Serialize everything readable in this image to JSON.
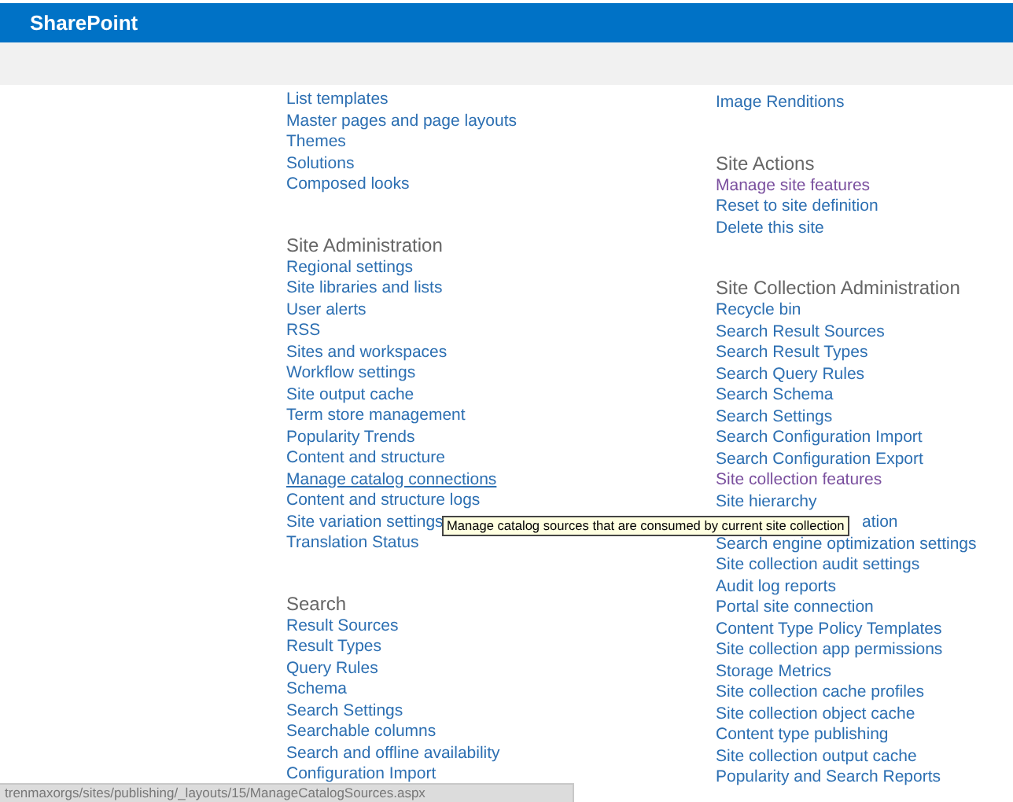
{
  "app_title": "SharePoint",
  "columns": [
    {
      "groups": [
        {
          "items": [
            {
              "label": "List templates",
              "visited": false,
              "hovered": false
            },
            {
              "label": "Master pages and page layouts",
              "visited": false,
              "hovered": false
            },
            {
              "label": "Themes",
              "visited": false,
              "hovered": false
            },
            {
              "label": "Solutions",
              "visited": false,
              "hovered": false
            },
            {
              "label": "Composed looks",
              "visited": false,
              "hovered": false
            }
          ]
        },
        {
          "heading": "Site Administration",
          "items": [
            {
              "label": "Regional settings",
              "visited": false,
              "hovered": false
            },
            {
              "label": "Site libraries and lists",
              "visited": false,
              "hovered": false
            },
            {
              "label": "User alerts",
              "visited": false,
              "hovered": false
            },
            {
              "label": "RSS",
              "visited": false,
              "hovered": false
            },
            {
              "label": "Sites and workspaces",
              "visited": false,
              "hovered": false
            },
            {
              "label": "Workflow settings",
              "visited": false,
              "hovered": false
            },
            {
              "label": "Site output cache",
              "visited": false,
              "hovered": false
            },
            {
              "label": "Term store management",
              "visited": false,
              "hovered": false
            },
            {
              "label": "Popularity Trends",
              "visited": false,
              "hovered": false
            },
            {
              "label": "Content and structure",
              "visited": false,
              "hovered": false
            },
            {
              "label": "Manage catalog connections",
              "visited": false,
              "hovered": true
            },
            {
              "label": "Content and structure logs",
              "visited": false,
              "hovered": false
            },
            {
              "label": "Site variation settings",
              "visited": false,
              "hovered": false
            },
            {
              "label": "Translation Status",
              "visited": false,
              "hovered": false
            }
          ]
        },
        {
          "heading": "Search",
          "items": [
            {
              "label": "Result Sources",
              "visited": false,
              "hovered": false
            },
            {
              "label": "Result Types",
              "visited": false,
              "hovered": false
            },
            {
              "label": "Query Rules",
              "visited": false,
              "hovered": false
            },
            {
              "label": "Schema",
              "visited": false,
              "hovered": false
            },
            {
              "label": "Search Settings",
              "visited": false,
              "hovered": false
            },
            {
              "label": "Searchable columns",
              "visited": false,
              "hovered": false
            },
            {
              "label": "Search and offline availability",
              "visited": false,
              "hovered": false
            },
            {
              "label": "Configuration Import",
              "visited": false,
              "hovered": false
            }
          ]
        }
      ]
    },
    {
      "groups": [
        {
          "items": [
            {
              "label": "Image Renditions",
              "visited": false,
              "hovered": false
            }
          ]
        },
        {
          "heading": "Site Actions",
          "items": [
            {
              "label": "Manage site features",
              "visited": true,
              "hovered": false
            },
            {
              "label": "Reset to site definition",
              "visited": false,
              "hovered": false
            },
            {
              "label": "Delete this site",
              "visited": false,
              "hovered": false
            }
          ]
        },
        {
          "heading": "Site Collection Administration",
          "items": [
            {
              "label": "Recycle bin",
              "visited": false,
              "hovered": false
            },
            {
              "label": "Search Result Sources",
              "visited": false,
              "hovered": false
            },
            {
              "label": "Search Result Types",
              "visited": false,
              "hovered": false
            },
            {
              "label": "Search Query Rules",
              "visited": false,
              "hovered": false
            },
            {
              "label": "Search Schema",
              "visited": false,
              "hovered": false
            },
            {
              "label": "Search Settings",
              "visited": false,
              "hovered": false
            },
            {
              "label": "Search Configuration Import",
              "visited": false,
              "hovered": false
            },
            {
              "label": "Search Configuration Export",
              "visited": false,
              "hovered": false
            },
            {
              "label": "Site collection features",
              "visited": true,
              "hovered": false
            },
            {
              "label": "Site hierarchy",
              "visited": false,
              "hovered": false
            },
            {
              "label": "ation",
              "visited": false,
              "hovered": false,
              "covered": true
            },
            {
              "label": "Search engine optimization settings",
              "visited": false,
              "hovered": false
            },
            {
              "label": "Site collection audit settings",
              "visited": false,
              "hovered": false
            },
            {
              "label": "Audit log reports",
              "visited": false,
              "hovered": false
            },
            {
              "label": "Portal site connection",
              "visited": false,
              "hovered": false
            },
            {
              "label": "Content Type Policy Templates",
              "visited": false,
              "hovered": false
            },
            {
              "label": "Site collection app permissions",
              "visited": false,
              "hovered": false
            },
            {
              "label": "Storage Metrics",
              "visited": false,
              "hovered": false
            },
            {
              "label": "Site collection cache profiles",
              "visited": false,
              "hovered": false
            },
            {
              "label": "Site collection object cache",
              "visited": false,
              "hovered": false
            },
            {
              "label": "Content type publishing",
              "visited": false,
              "hovered": false
            },
            {
              "label": "Site collection output cache",
              "visited": false,
              "hovered": false
            },
            {
              "label": "Popularity and Search Reports",
              "visited": false,
              "hovered": false
            }
          ]
        }
      ]
    }
  ],
  "tooltip": "Manage catalog sources that are consumed by current site collection",
  "status_bar": "trenmaxorgs/sites/publishing/_layouts/15/ManageCatalogSources.aspx"
}
